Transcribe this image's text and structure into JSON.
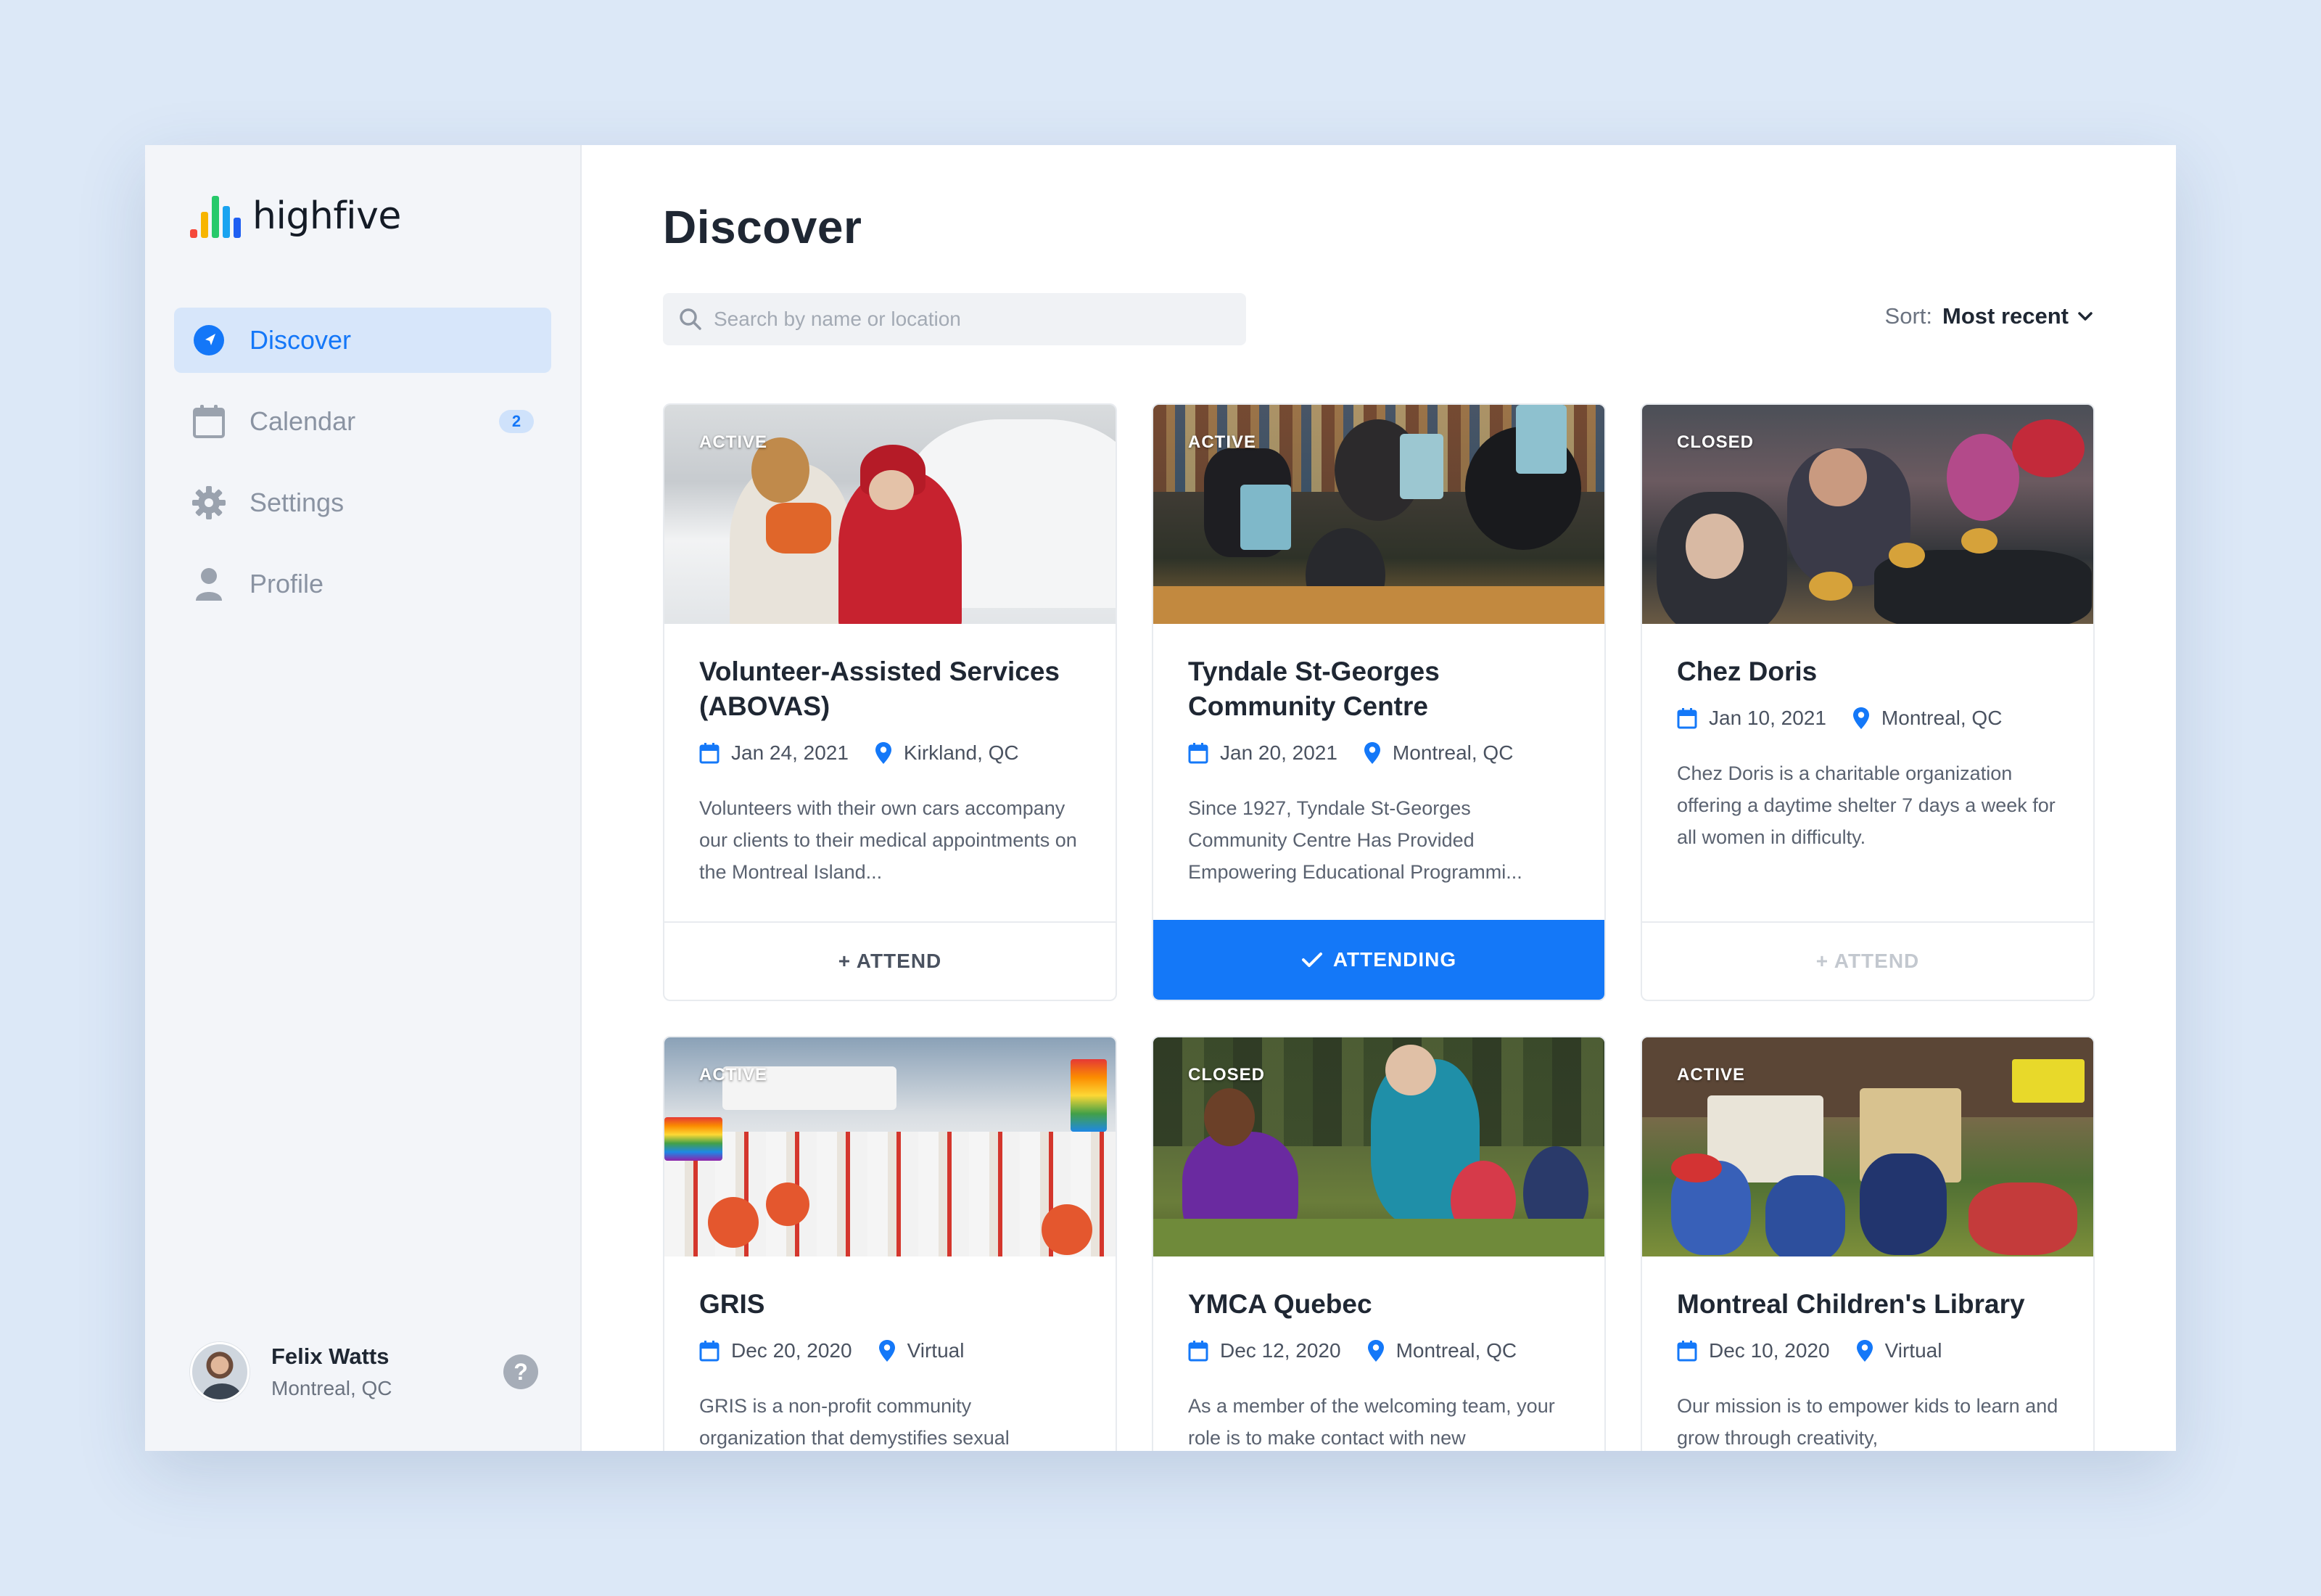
{
  "app": {
    "logo_text": "highfive",
    "logo_colors": [
      "#f5483b",
      "#f7b500",
      "#27c96a",
      "#1aa3f0",
      "#1f5ff2"
    ]
  },
  "nav": {
    "items": [
      {
        "label": "Discover",
        "active": true,
        "icon": "compass-icon"
      },
      {
        "label": "Calendar",
        "badge": "2",
        "icon": "calendar-icon"
      },
      {
        "label": "Settings",
        "icon": "gear-icon"
      },
      {
        "label": "Profile",
        "icon": "user-icon"
      }
    ]
  },
  "user": {
    "name": "Felix Watts",
    "location": "Montreal, QC",
    "help_icon": "question-icon",
    "help_glyph": "?"
  },
  "main": {
    "title": "Discover",
    "search": {
      "placeholder": "Search by name or location",
      "value": ""
    },
    "sort": {
      "label": "Sort:",
      "value": "Most recent"
    }
  },
  "cards": [
    {
      "status": "ACTIVE",
      "title": "Volunteer-Assisted Services (ABOVAS)",
      "date": "Jan 24, 2021",
      "location": "Kirkland, QC",
      "description": "Volunteers with their own cars accompany our clients to their medical appointments on the Montreal Island...",
      "button": "+ ATTEND",
      "button_state": "default"
    },
    {
      "status": "ACTIVE",
      "title": "Tyndale St-Georges Community Centre",
      "date": "Jan 20, 2021",
      "location": "Montreal, QC",
      "description": "Since 1927, Tyndale St-Georges Community Centre Has Provided Empowering Educational Programmi...",
      "button": "ATTENDING",
      "button_state": "attending"
    },
    {
      "status": "CLOSED",
      "title": "Chez Doris",
      "date": "Jan 10, 2021",
      "location": "Montreal, QC",
      "description": "Chez Doris is a charitable organization offering a daytime shelter 7 days a week for all women in difficulty.",
      "button": "+ ATTEND",
      "button_state": "disabled"
    },
    {
      "status": "ACTIVE",
      "title": "GRIS",
      "date": "Dec 20, 2020",
      "location": "Virtual",
      "description": "GRIS is a non-profit community organization that demystifies sexual"
    },
    {
      "status": "CLOSED",
      "title": "YMCA Quebec",
      "date": "Dec 12, 2020",
      "location": "Montreal, QC",
      "description": "As a member of the welcoming team, your role is to make contact with new"
    },
    {
      "status": "ACTIVE",
      "title": "Montreal Children's Library",
      "date": "Dec 10, 2020",
      "location": "Virtual",
      "description": "Our mission is to empower kids to learn and grow through creativity,"
    }
  ],
  "colors": {
    "accent": "#1478f8",
    "sidebar_bg": "#f3f5f9",
    "page_bg": "#dce8f7",
    "text_dark": "#1f2733"
  }
}
